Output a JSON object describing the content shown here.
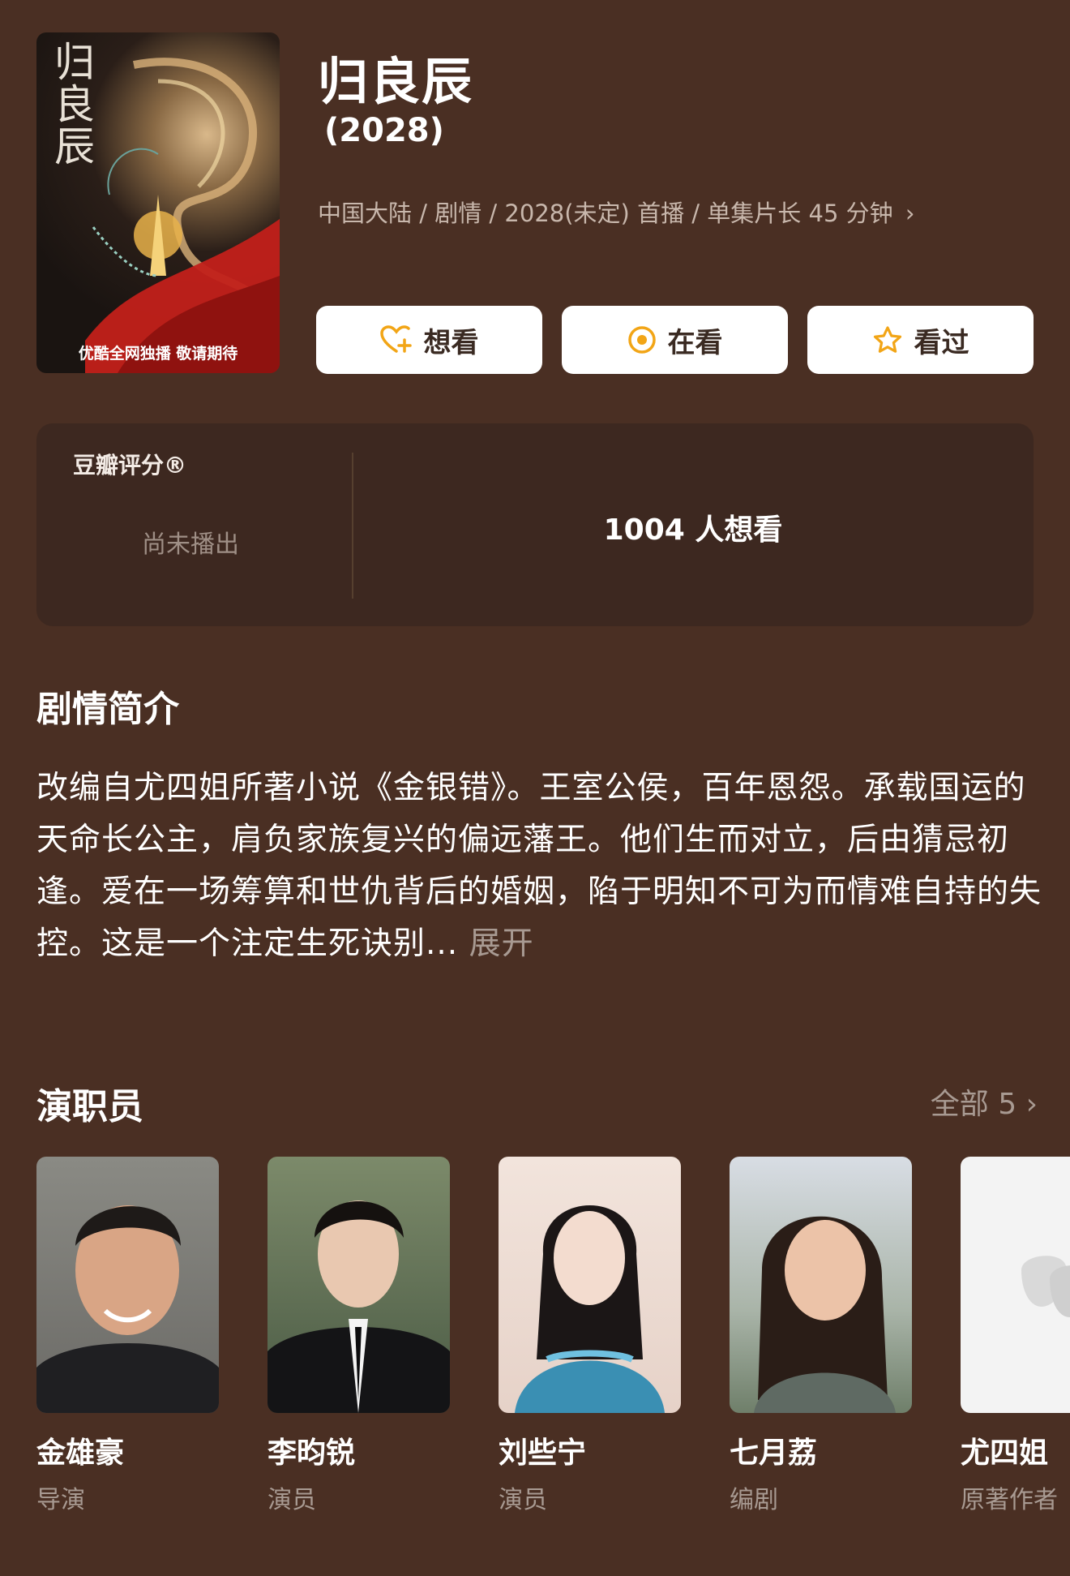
{
  "poster": {
    "title_text": "归良辰",
    "caption": "优酷全网独播 敬请期待"
  },
  "header": {
    "title": "归良辰",
    "year": "(2028)",
    "meta": "中国大陆 / 剧情 / 2028(未定) 首播 / 单集片长 45 分钟"
  },
  "actions": {
    "want": "想看",
    "watching": "在看",
    "watched": "看过"
  },
  "rating": {
    "label": "豆瓣评分®",
    "status": "尚未播出",
    "want_count": "1004 人想看"
  },
  "synopsis": {
    "title": "剧情简介",
    "text": "改编自尤四姐所著小说《金银错》。王室公侯，百年恩怨。承载国运的天命长公主，肩负家族复兴的偏远藩王。他们生而对立，后由猜忌初逢。爱在一场筹算和世仇背后的婚姻，陷于明知不可为而情难自持的失控。这是一个注定生死诀别...",
    "more": "展开"
  },
  "cast": {
    "title": "演职员",
    "all_label": "全部 5",
    "members": [
      {
        "name": "金雄豪",
        "role": "导演"
      },
      {
        "name": "李昀锐",
        "role": "演员"
      },
      {
        "name": "刘些宁",
        "role": "演员"
      },
      {
        "name": "七月荔",
        "role": "编剧"
      },
      {
        "name": "尤四姐",
        "role": "原著作者"
      }
    ]
  },
  "colors": {
    "background": "#4a2f23",
    "card": "#3d2820",
    "accent": "#f2a516",
    "muted_text": "#a89a92"
  }
}
